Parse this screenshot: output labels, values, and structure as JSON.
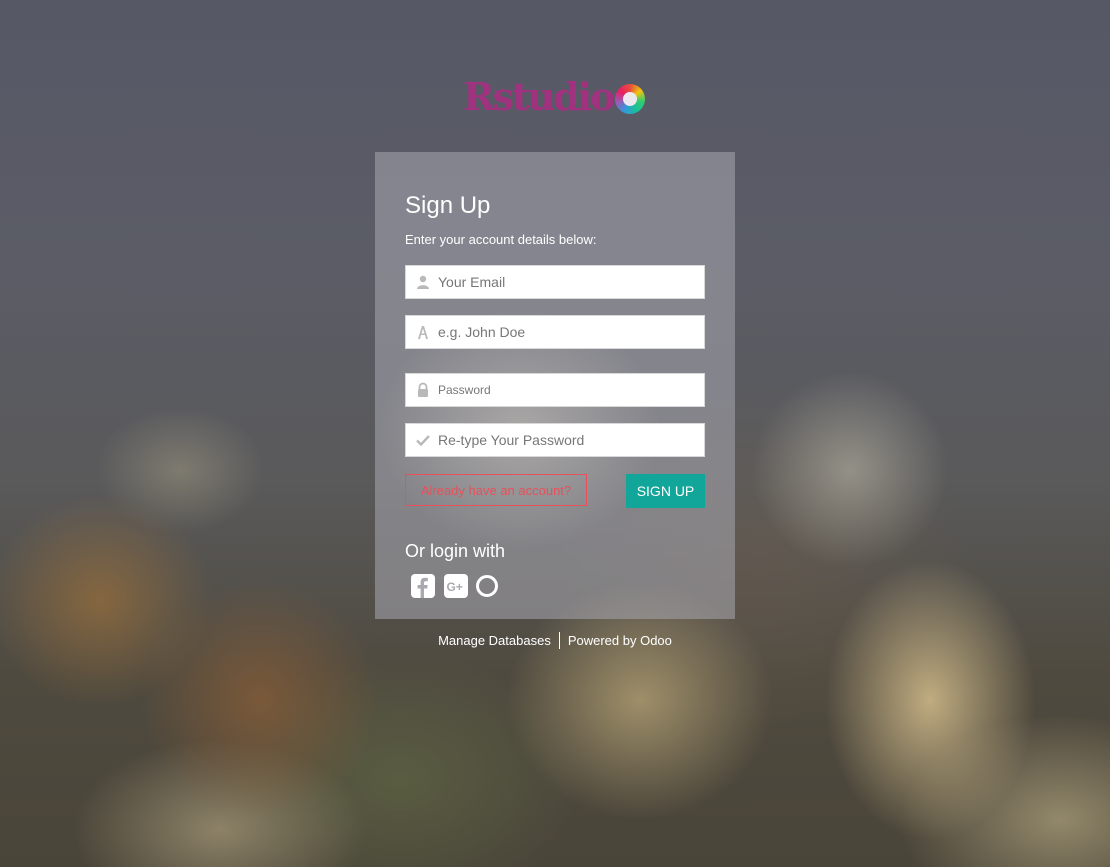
{
  "brand": {
    "logo_text": "Rstudio"
  },
  "form": {
    "title": "Sign Up",
    "subtitle": "Enter your account details below:",
    "email_placeholder": "Your Email",
    "name_placeholder": "e.g. John Doe",
    "password_placeholder": "Password",
    "confirm_placeholder": "Re-type Your Password",
    "already_label": "Already have an account?",
    "signup_label": "SIGN UP"
  },
  "social": {
    "heading": "Or login with",
    "providers": [
      "facebook-icon",
      "google-plus-icon",
      "odoo-icon"
    ]
  },
  "footer": {
    "manage_label": "Manage Databases",
    "powered_label": "Powered by Odoo"
  },
  "colors": {
    "accent": "#12a59a",
    "error": "#e8505b",
    "brand": "#a1327f"
  }
}
